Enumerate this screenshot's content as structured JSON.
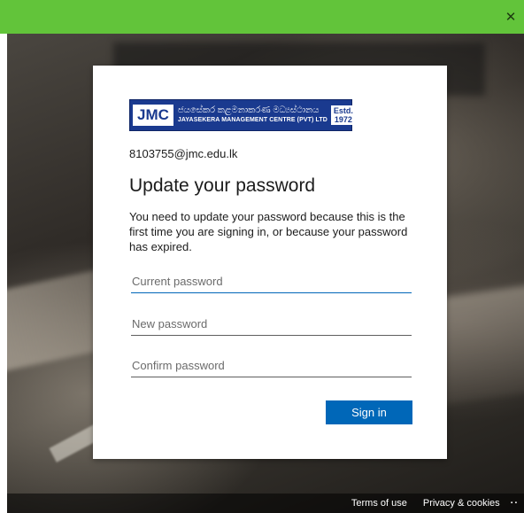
{
  "window": {
    "titlebar_color": "#62c43a",
    "close_glyph": "✕"
  },
  "brand": {
    "logo_main": "JMC",
    "logo_sinhala": "ජයසේකර කළමනාකරණ මධ්‍යස්ථානය",
    "logo_english": "JAYASEKERA MANAGEMENT CENTRE (PVT) LTD",
    "logo_estd": "Estd.",
    "logo_year": "1972",
    "logo_color": "#1a3a8f"
  },
  "card": {
    "email": "8103755@jmc.edu.lk",
    "title": "Update your password",
    "description": "You need to update your password because this is the first time you are signing in, or because your password has expired.",
    "fields": {
      "current_placeholder": "Current password",
      "new_placeholder": "New password",
      "confirm_placeholder": "Confirm password"
    },
    "signin_label": "Sign in",
    "accent_color": "#0067b8"
  },
  "footer": {
    "terms": "Terms of use",
    "privacy": "Privacy & cookies",
    "more": "··"
  }
}
